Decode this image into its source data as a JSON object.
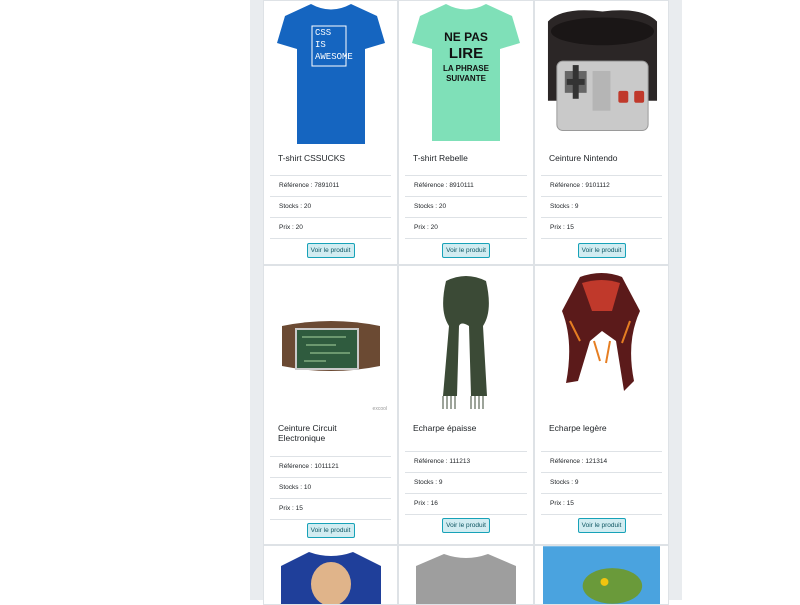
{
  "products": [
    {
      "name": "T-shirt CSSUCKS",
      "reference_label": "Référence : 7891011",
      "stock_label": "Stocks : 20",
      "price_label": "Prix : 20",
      "button_label": "Voir le produit",
      "image_text": [
        "CSS",
        "IS",
        "AWESOME"
      ],
      "image_icon": "tshirt-blue"
    },
    {
      "name": "T-shirt Rebelle",
      "reference_label": "Référence : 8910111",
      "stock_label": "Stocks : 20",
      "price_label": "Prix : 20",
      "button_label": "Voir le produit",
      "image_text": [
        "NE PAS",
        "LIRE",
        "LA PHRASE",
        "SUIVANTE"
      ],
      "image_icon": "tshirt-mint"
    },
    {
      "name": "Ceinture Nintendo",
      "reference_label": "Référence : 9101112",
      "stock_label": "Stocks : 9",
      "price_label": "Prix : 15",
      "button_label": "Voir le produit",
      "image_icon": "belt-nintendo"
    },
    {
      "name": "Ceinture Circuit Electronique",
      "reference_label": "Référence : 1011121",
      "stock_label": "Stocks : 10",
      "price_label": "Prix : 15",
      "button_label": "Voir le produit",
      "image_icon": "belt-circuit",
      "image_caption": "excool"
    },
    {
      "name": "Echarpe épaisse",
      "reference_label": "Référence : 111213",
      "stock_label": "Stocks : 9",
      "price_label": "Prix : 16",
      "button_label": "Voir le produit",
      "image_icon": "scarf-green"
    },
    {
      "name": "Echarpe legère",
      "reference_label": "Référence : 121314",
      "stock_label": "Stocks : 9",
      "price_label": "Prix : 15",
      "button_label": "Voir le produit",
      "image_icon": "scarf-red"
    }
  ],
  "next_row_icons": [
    "tshirt-character",
    "tshirt-grey",
    "poster-dragon"
  ],
  "colors": {
    "accent_bg": "#d1ecf1",
    "accent_border": "#17a2b8",
    "accent_text": "#0c5460",
    "frame": "#e9ecef"
  }
}
